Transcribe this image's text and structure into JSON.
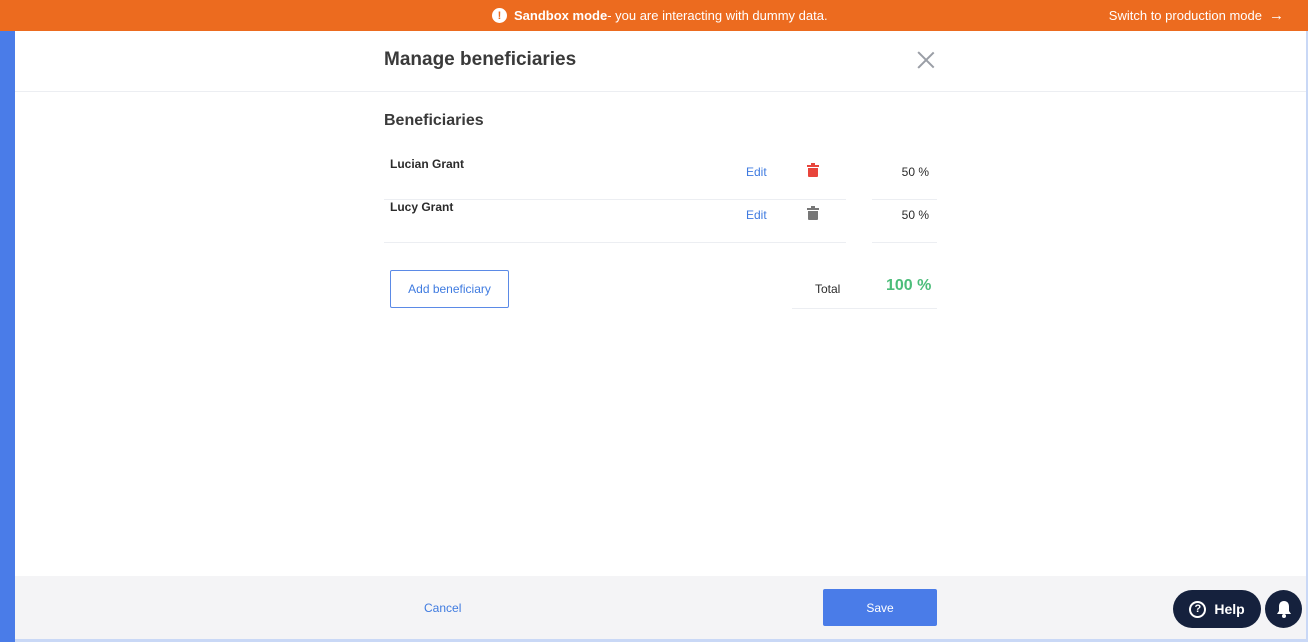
{
  "banner": {
    "mode_label": "Sandbox mode",
    "message": " - you are interacting with dummy data.",
    "switch_label": "Switch to production mode",
    "icon": "exclamation-circle-icon",
    "color": "#ec6b1f"
  },
  "modal": {
    "title": "Manage beneficiaries",
    "section_title": "Beneficiaries",
    "beneficiaries": [
      {
        "name": "Lucian Grant",
        "edit_label": "Edit",
        "percent": "50 %",
        "trash_color": "#e8453c"
      },
      {
        "name": "Lucy Grant",
        "edit_label": "Edit",
        "percent": "50 %",
        "trash_color": "#777777"
      }
    ],
    "add_button_label": "Add beneficiary",
    "total_label": "Total",
    "total_value": "100 %",
    "total_color": "#4cbd7a"
  },
  "footer": {
    "cancel_label": "Cancel",
    "save_label": "Save"
  },
  "widgets": {
    "help_label": "Help"
  },
  "colors": {
    "accent": "#4a7ce8",
    "link": "#3f7be0",
    "help_bg": "#15213d"
  }
}
